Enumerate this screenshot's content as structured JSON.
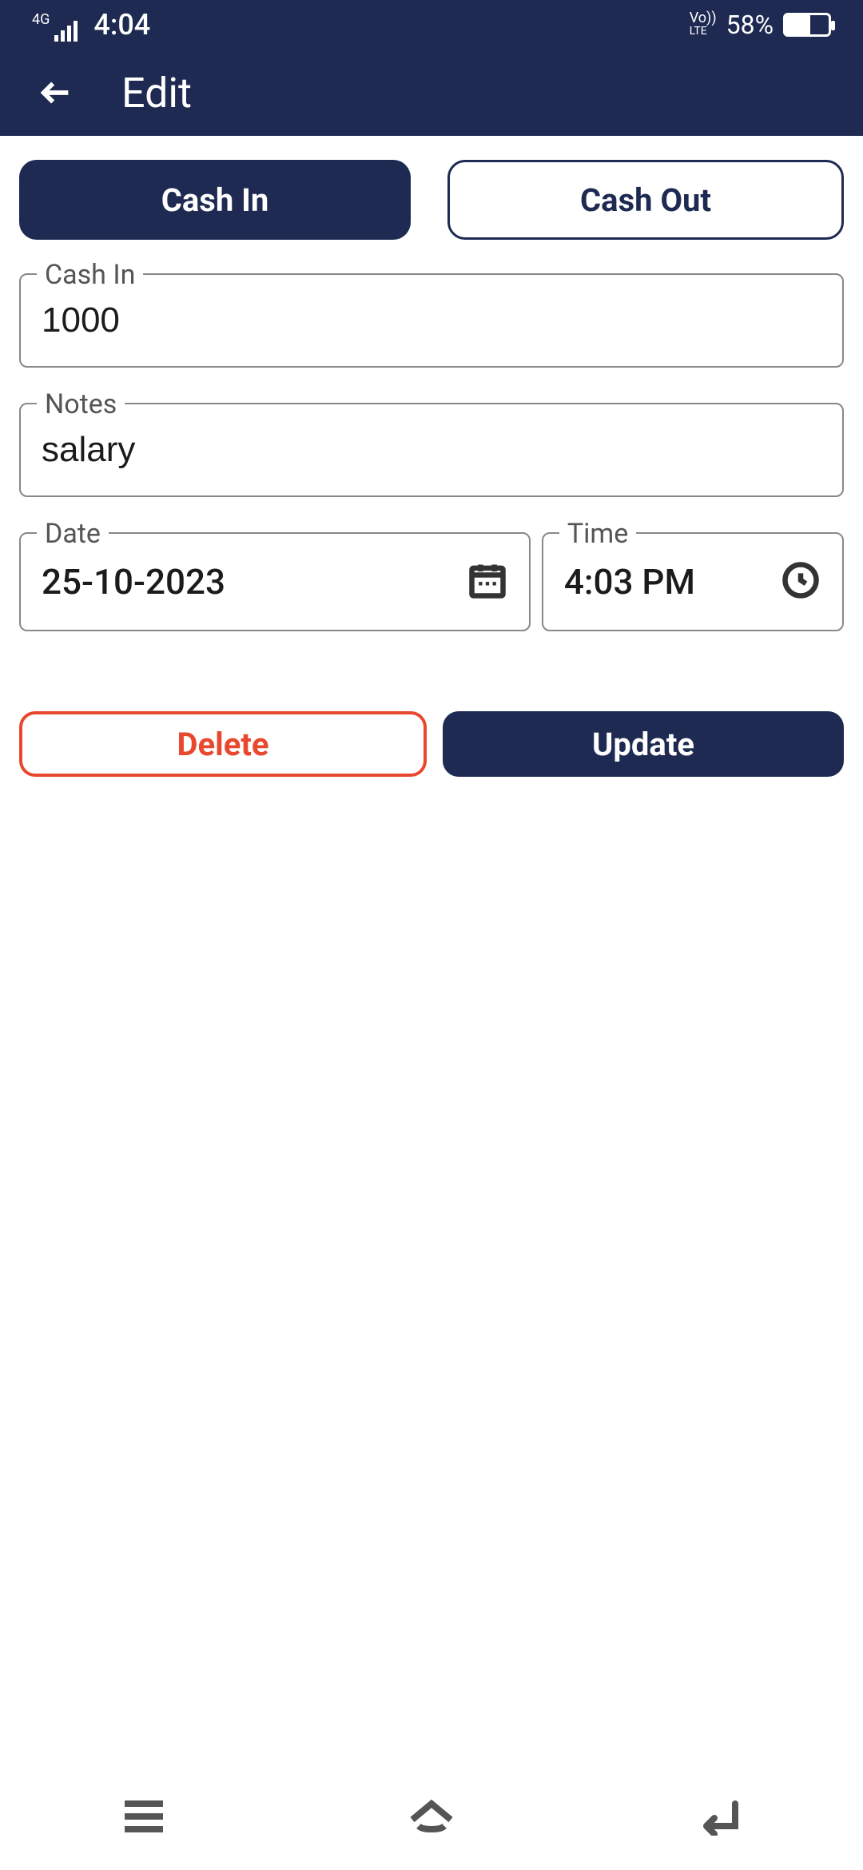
{
  "status": {
    "network": "4G",
    "clock": "4:04",
    "volte": "Vo))\nLTE",
    "battery_pct": "58%"
  },
  "appbar": {
    "title": "Edit"
  },
  "toggle": {
    "cash_in": "Cash In",
    "cash_out": "Cash Out"
  },
  "fields": {
    "amount_label": "Cash In",
    "amount_value": "1000",
    "notes_label": "Notes",
    "notes_value": "salary",
    "date_label": "Date",
    "date_value": "25-10-2023",
    "time_label": "Time",
    "time_value": "4:03 PM"
  },
  "actions": {
    "delete": "Delete",
    "update": "Update"
  },
  "colors": {
    "primary": "#1e2a52",
    "danger": "#e8482e"
  }
}
